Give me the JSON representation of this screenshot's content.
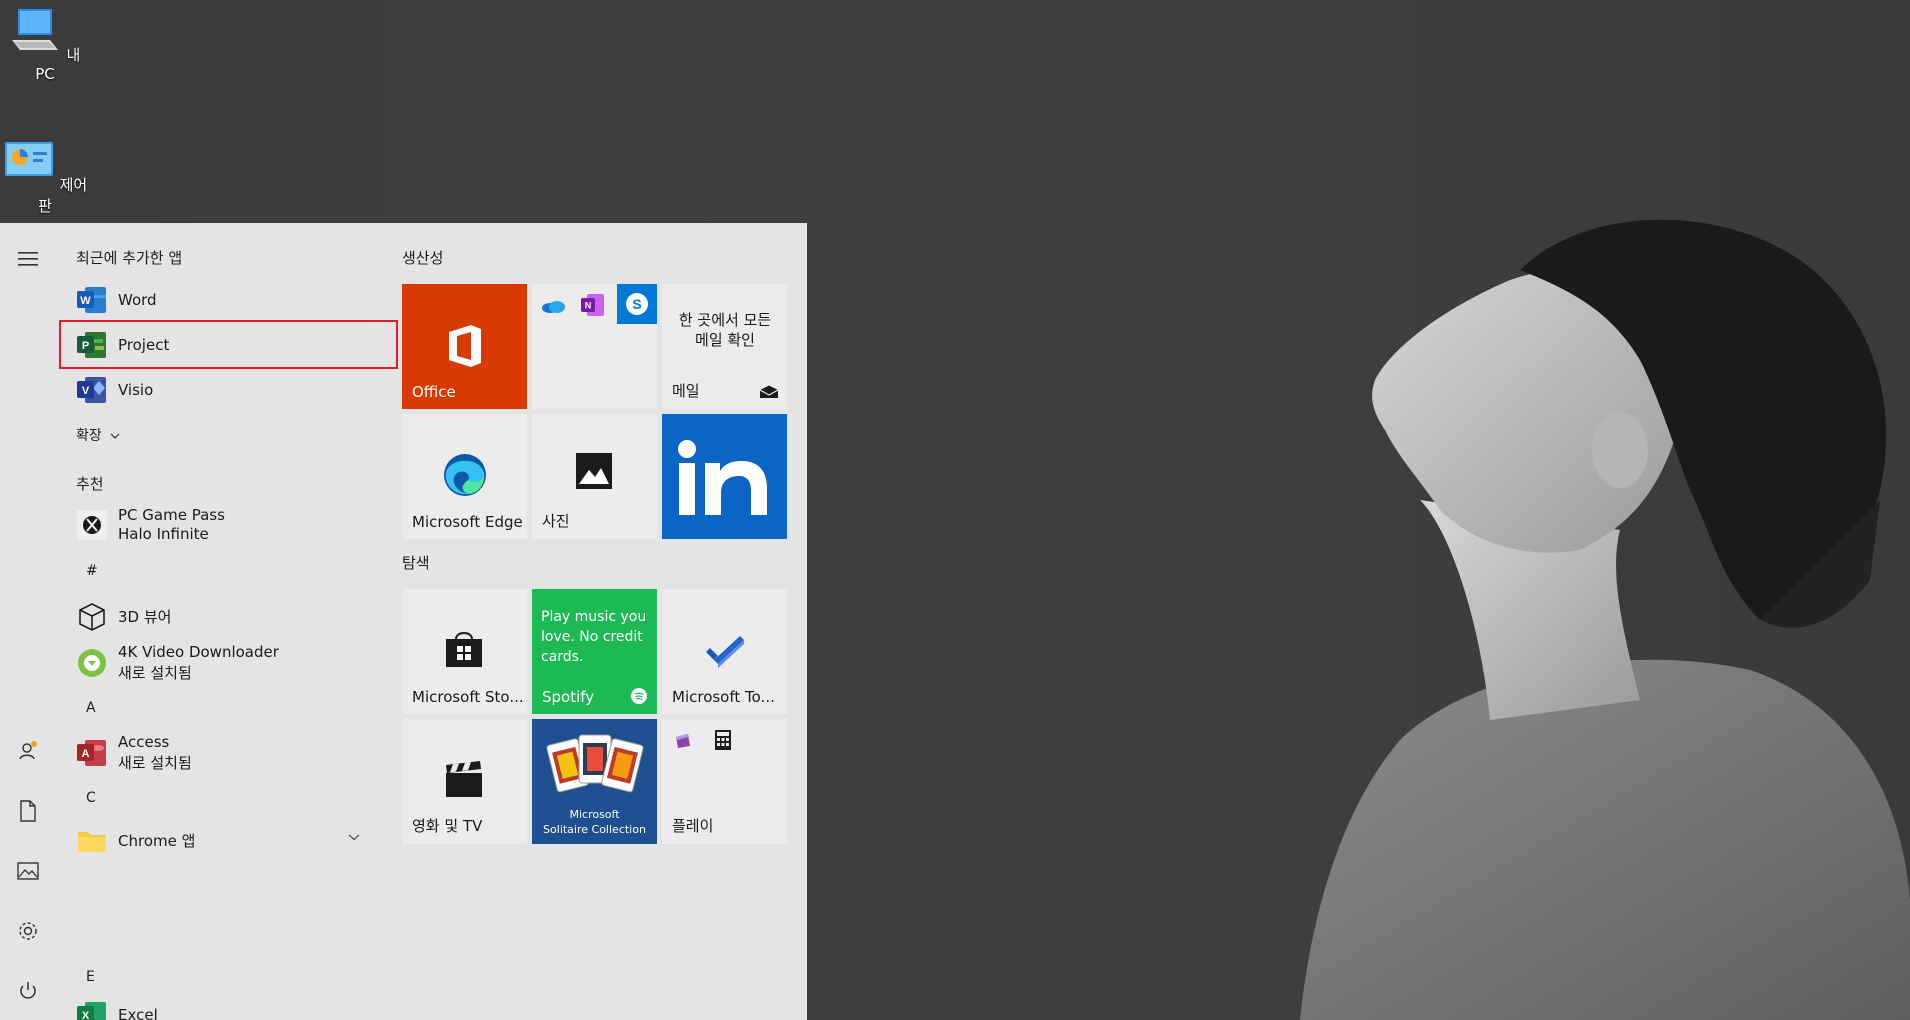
{
  "desktop": {
    "icons": [
      {
        "label": "내 PC",
        "icon": "computer-icon"
      },
      {
        "label": "제어판",
        "icon": "control-panel-icon"
      }
    ]
  },
  "start_menu": {
    "recent": {
      "title": "최근에 추가한 앱",
      "items": [
        {
          "name": "Word",
          "icon": "word-icon"
        },
        {
          "name": "Project",
          "icon": "project-icon"
        },
        {
          "name": "Visio",
          "icon": "visio-icon"
        }
      ],
      "expand_label": "확장"
    },
    "recommended": {
      "title": "추천",
      "item": {
        "line1": "PC Game Pass",
        "line2": "Halo Infinite",
        "icon": "xbox-icon"
      }
    },
    "apps": {
      "hash_header": "#",
      "viewer_3d": "3D 뷰어",
      "downloader": {
        "name": "4K Video Downloader",
        "sub": "새로 설치됨"
      },
      "a_header": "A",
      "access": {
        "name": "Access",
        "sub": "새로 설치됨"
      },
      "c_header": "C",
      "chrome": {
        "name": "Chrome 앱"
      },
      "e_header": "E",
      "excel": {
        "name": "Excel"
      }
    }
  },
  "tiles": {
    "productivity": {
      "title": "생산성",
      "office": "Office",
      "mail": {
        "text": "한 곳에서 모든 메일 확인",
        "label": "메일"
      },
      "edge": "Microsoft Edge",
      "photos": "사진"
    },
    "explore": {
      "title": "탐색",
      "store": "Microsoft Sto...",
      "spotify": {
        "text": "Play music you love. No credit cards.",
        "label": "Spotify"
      },
      "todo": "Microsoft To...",
      "movies": "영화 및 TV",
      "solitaire": {
        "line1": "Microsoft",
        "line2": "Solitaire Collection"
      },
      "play": "플레이"
    }
  },
  "colors": {
    "office_tile": "#d83b01",
    "linkedin_tile": "#0a66c2",
    "spotify_tile": "#1db954",
    "solitaire_tile": "#1d4f91",
    "highlight": "#e21f27"
  }
}
